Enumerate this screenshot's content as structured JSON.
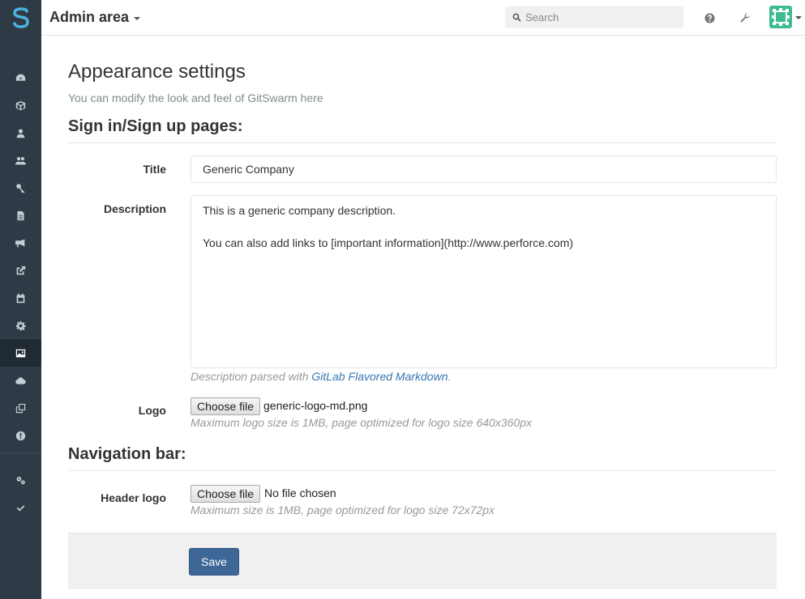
{
  "header": {
    "title": "Admin area",
    "search_placeholder": "Search"
  },
  "sidebar": {
    "items": [
      {
        "icon": "dashboard-icon"
      },
      {
        "icon": "cube-icon"
      },
      {
        "icon": "user-icon"
      },
      {
        "icon": "users-icon"
      },
      {
        "icon": "key-icon"
      },
      {
        "icon": "file-icon"
      },
      {
        "icon": "bullhorn-icon"
      },
      {
        "icon": "external-link-icon"
      },
      {
        "icon": "calendar-icon"
      },
      {
        "icon": "gear-icon"
      },
      {
        "icon": "image-icon",
        "active": true
      },
      {
        "icon": "cloud-icon"
      },
      {
        "icon": "clone-icon"
      },
      {
        "icon": "exclamation-icon"
      },
      {
        "icon": "cogs-icon"
      },
      {
        "icon": "check-icon"
      }
    ]
  },
  "page": {
    "title": "Appearance settings",
    "subtitle": "You can modify the look and feel of GitSwarm here"
  },
  "signin_section": {
    "heading": "Sign in/Sign up pages:",
    "title_label": "Title",
    "title_value": "Generic Company",
    "description_label": "Description",
    "description_value": "This is a generic company description.\n\nYou can also add links to [important information](http://www.perforce.com)",
    "description_help_prefix": "Description parsed with ",
    "description_help_link": "GitLab Flavored Markdown",
    "description_help_suffix": ".",
    "logo_label": "Logo",
    "logo_button": "Choose file",
    "logo_filename": "generic-logo-md.png",
    "logo_help": "Maximum logo size is 1MB, page optimized for logo size 640x360px"
  },
  "navbar_section": {
    "heading": "Navigation bar:",
    "header_logo_label": "Header logo",
    "header_logo_button": "Choose file",
    "header_logo_filename": "No file chosen",
    "header_logo_help": "Maximum size is 1MB, page optimized for logo size 72x72px"
  },
  "actions": {
    "save_label": "Save"
  },
  "colors": {
    "sidebar_bg": "#2e3b46",
    "accent": "#3e6797",
    "link": "#3777b0"
  }
}
